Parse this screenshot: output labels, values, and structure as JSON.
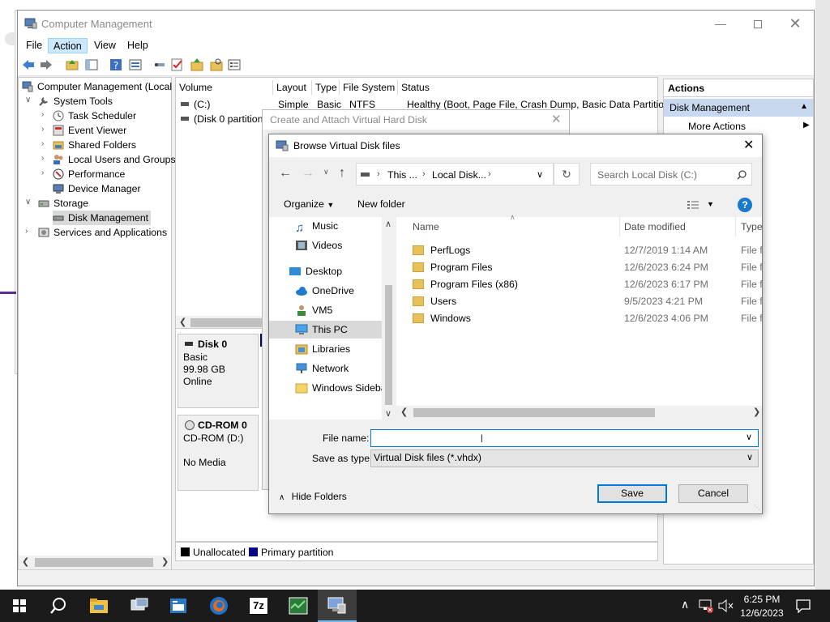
{
  "background_window": {},
  "cm": {
    "title": "Computer Management",
    "menu": [
      "File",
      "Action",
      "View",
      "Help"
    ],
    "tree": {
      "root": "Computer Management (Local",
      "system_tools": "System Tools",
      "task_scheduler": "Task Scheduler",
      "event_viewer": "Event Viewer",
      "shared_folders": "Shared Folders",
      "local_users": "Local Users and Groups",
      "performance": "Performance",
      "device_manager": "Device Manager",
      "storage": "Storage",
      "disk_management": "Disk Management",
      "services": "Services and Applications"
    },
    "columns": [
      "Volume",
      "Layout",
      "Type",
      "File System",
      "Status"
    ],
    "rows": [
      {
        "volume": "(C:)",
        "layout": "Simple",
        "type": "Basic",
        "fs": "NTFS",
        "status": "Healthy (Boot, Page File, Crash Dump, Basic Data Partition)"
      },
      {
        "volume": "(Disk 0 partition",
        "layout": "",
        "type": "",
        "fs": "",
        "status": ""
      }
    ],
    "disk0": {
      "name": "Disk 0",
      "type": "Basic",
      "size": "99.98 GB",
      "status": "Online"
    },
    "cdrom": {
      "name": "CD-ROM 0",
      "type": "CD-ROM (D:)",
      "status": "No Media"
    },
    "legend": {
      "unallocated": "Unallocated",
      "primary": "Primary partition"
    },
    "actions": {
      "header": "Actions",
      "section": "Disk Management",
      "more": "More Actions"
    }
  },
  "wizard": {
    "title": "Create and Attach Virtual Hard Disk"
  },
  "browse": {
    "title": "Browse Virtual Disk files",
    "address": {
      "part1": "This ...",
      "part2": "Local Disk..."
    },
    "search_placeholder": "Search Local Disk (C:)",
    "organize": "Organize",
    "new_folder": "New folder",
    "nav": {
      "music": "Music",
      "videos": "Videos",
      "desktop": "Desktop",
      "onedrive": "OneDrive",
      "vm5": "VM5",
      "thispc": "This PC",
      "libraries": "Libraries",
      "network": "Network",
      "sidebar": "Windows Sideba"
    },
    "columns": {
      "name": "Name",
      "date": "Date modified",
      "type": "Type"
    },
    "files": [
      {
        "name": "PerfLogs",
        "date": "12/7/2019 1:14 AM",
        "type": "File fo"
      },
      {
        "name": "Program Files",
        "date": "12/6/2023 6:24 PM",
        "type": "File fo"
      },
      {
        "name": "Program Files (x86)",
        "date": "12/6/2023 6:17 PM",
        "type": "File fo"
      },
      {
        "name": "Users",
        "date": "9/5/2023 4:21 PM",
        "type": "File fo"
      },
      {
        "name": "Windows",
        "date": "12/6/2023 4:06 PM",
        "type": "File fo"
      }
    ],
    "file_name_label": "File name:",
    "file_name_value": "",
    "save_type_label": "Save as type:",
    "save_type_value": "Virtual Disk files (*.vhdx)",
    "hide_folders": "Hide Folders",
    "save": "Save",
    "cancel": "Cancel"
  },
  "taskbar": {
    "time": "6:25 PM",
    "date": "12/6/2023",
    "sevenzip": "7z"
  },
  "colors": {
    "accent": "#0078d7",
    "selection": "#cce8ff",
    "primary_partition": "#00008b"
  }
}
